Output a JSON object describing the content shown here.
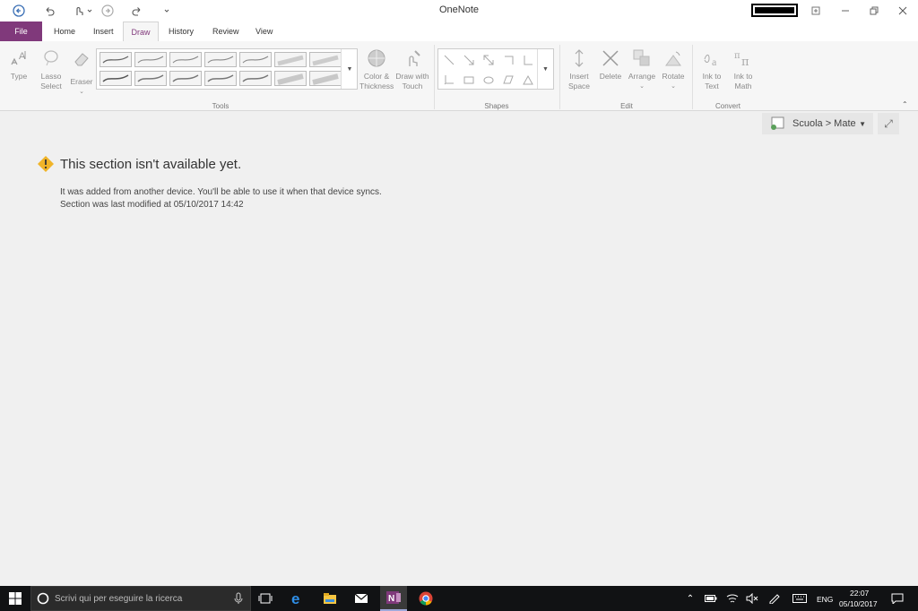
{
  "window": {
    "title": "OneNote"
  },
  "tabs": [
    {
      "label": "File"
    },
    {
      "label": "Home"
    },
    {
      "label": "Insert"
    },
    {
      "label": "Draw"
    },
    {
      "label": "History"
    },
    {
      "label": "Review"
    },
    {
      "label": "View"
    }
  ],
  "ribbon": {
    "tools": {
      "type_label": "Type",
      "lasso_label_1": "Lasso",
      "lasso_label_2": "Select",
      "eraser_label": "Eraser",
      "color_label_1": "Color &",
      "color_label_2": "Thickness",
      "draw_touch_label_1": "Draw with",
      "draw_touch_label_2": "Touch",
      "group_label": "Tools"
    },
    "shapes": {
      "group_label": "Shapes"
    },
    "edit": {
      "insert_space_1": "Insert",
      "insert_space_2": "Space",
      "delete_label": "Delete",
      "arrange_label": "Arrange",
      "rotate_label": "Rotate",
      "group_label": "Edit"
    },
    "convert": {
      "ink_text_1": "Ink to",
      "ink_text_2": "Text",
      "ink_math_1": "Ink to",
      "ink_math_2": "Math",
      "group_label": "Convert"
    }
  },
  "notebook": {
    "section_path": "Scuola > Mate"
  },
  "message": {
    "title": "This section isn't available yet.",
    "line1": "It was added from another device. You'll be able to use it when that device syncs.",
    "line2": "Section was last modified at 05/10/2017 14:42"
  },
  "taskbar": {
    "search_placeholder": "Scrivi qui per eseguire la ricerca",
    "language": "ENG",
    "time": "22:07",
    "date": "05/10/2017"
  },
  "colors": {
    "accent": "#80397b",
    "warning": "#f0b429"
  }
}
